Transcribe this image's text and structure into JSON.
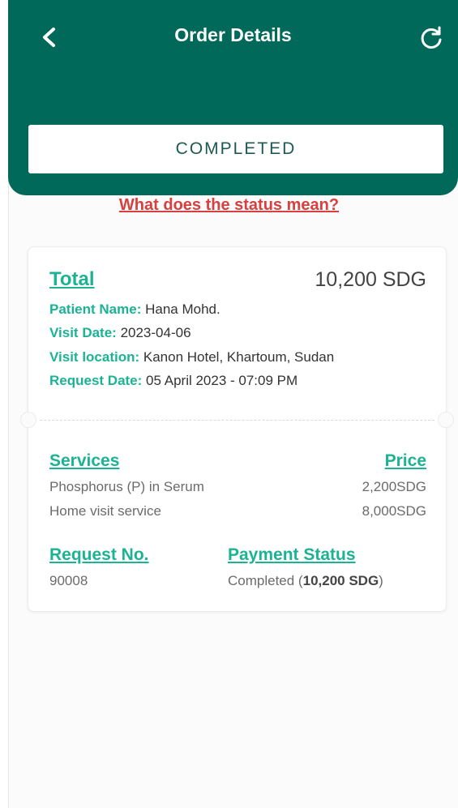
{
  "header": {
    "title": "Order Details",
    "status": "COMPLETED",
    "icons": {
      "back": "chevron-left-icon",
      "refresh": "refresh-icon"
    },
    "bg_color": "#00695a"
  },
  "status_help_link": "What does the status mean?",
  "order": {
    "total_label": "Total",
    "total_value": "10,200 SDG",
    "patient_label": "Patient Name:",
    "patient_value": "Hana Mohd.",
    "visit_date_label": "Visit Date:",
    "visit_date_value": "2023-04-06",
    "visit_location_label": "Visit location:",
    "visit_location_value": "Kanon Hotel, Khartoum, Sudan",
    "request_date_label": "Request Date:",
    "request_date_value": "05 April 2023 - 07:09 PM"
  },
  "services": {
    "services_header": "Services",
    "price_header": "Price",
    "items": [
      {
        "name": "Phosphorus (P) in Serum",
        "price": "2,200SDG"
      },
      {
        "name": "Home visit service",
        "price": "8,000SDG"
      }
    ]
  },
  "request": {
    "request_no_header": "Request No.",
    "request_no_value": "90008",
    "payment_status_header": "Payment Status",
    "payment_status_prefix": "Completed (",
    "payment_status_amount": "10,200 SDG",
    "payment_status_suffix": ")"
  },
  "colors": {
    "accent": "#1bb393",
    "link": "#d8403f"
  }
}
